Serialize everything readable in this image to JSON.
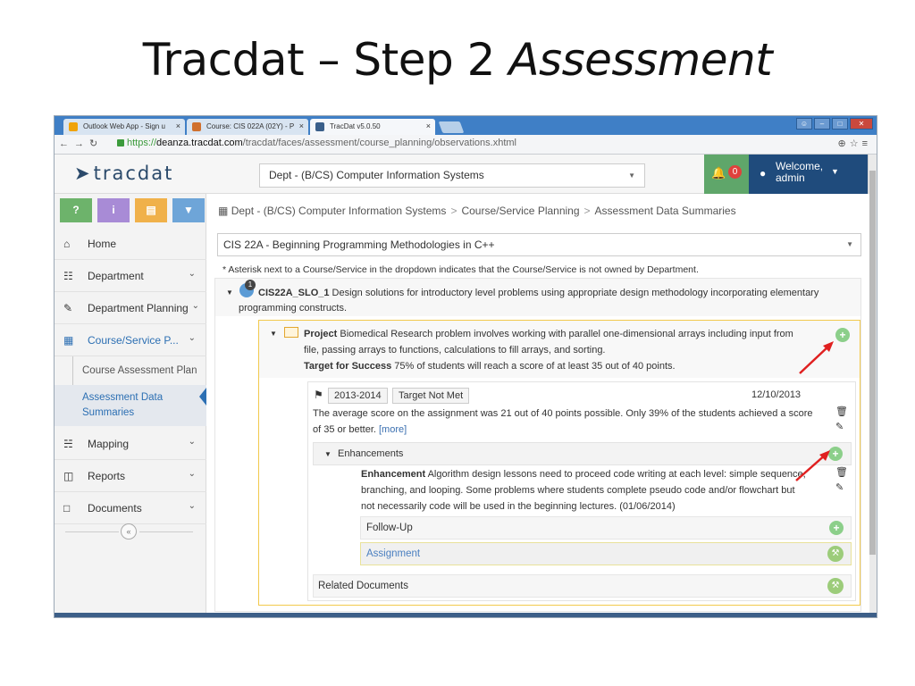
{
  "slide": {
    "title_main": "Tracdat – Step 2 ",
    "title_italic": "Assessment"
  },
  "browser": {
    "tabs": [
      {
        "label": "Outlook Web App - Sign u",
        "icon_color": "#f0a30a"
      },
      {
        "label": "Course: CIS 022A (02Y) - P",
        "icon_color": "#d0702e"
      },
      {
        "label": "TracDat v5.0.50",
        "icon_color": "#3a5f8a"
      }
    ],
    "tab_close": "×",
    "url_scheme": "https://",
    "url_host": "deanza.tracdat.com",
    "url_path": "/tracdat/faces/assessment/course_planning/observations.xhtml"
  },
  "header": {
    "logo": "tracdat",
    "department": "Dept - (B/CS) Computer Information Systems",
    "notifications": "0",
    "welcome_line1": "Welcome,",
    "welcome_line2": "admin"
  },
  "sidebar": {
    "quick_buttons": [
      {
        "label": "?",
        "color": "#6db36b",
        "name": "help"
      },
      {
        "label": "i",
        "color": "#a88bd6",
        "name": "info"
      },
      {
        "label": "▤",
        "color": "#f0b14a",
        "name": "notes"
      },
      {
        "label": "▼",
        "color": "#6ea5d8",
        "name": "filter"
      }
    ],
    "items": [
      {
        "label": "Home",
        "icon": "home-icon"
      },
      {
        "label": "Department",
        "icon": "institution-icon"
      },
      {
        "label": "Department Planning",
        "icon": "pencil-icon"
      },
      {
        "label": "Course/Service P...",
        "icon": "book-icon"
      },
      {
        "label": "Mapping",
        "icon": "sitemap-icon"
      },
      {
        "label": "Reports",
        "icon": "columns-icon"
      },
      {
        "label": "Documents",
        "icon": "folder-icon"
      }
    ],
    "subitems": [
      {
        "label": "Course Assessment Plan"
      },
      {
        "label": "Assessment Data Summaries"
      }
    ],
    "collapse": "«"
  },
  "breadcrumb": {
    "items": [
      "Dept - (B/CS) Computer Information Systems",
      "Course/Service Planning",
      "Assessment Data Summaries"
    ],
    "sep": ">"
  },
  "course": {
    "selected": "CIS 22A - Beginning Programming Methodologies in C++",
    "note": "* Asterisk next to a Course/Service in the dropdown indicates that the Course/Service is not owned by Department."
  },
  "slo": {
    "count": "1",
    "code": "CIS22A_SLO_1",
    "text": "Design solutions for introductory level problems using appropriate design methodology incorporating elementary programming constructs."
  },
  "project": {
    "label": "Project",
    "text": "Biomedical Research problem involves working with parallel one-dimensional arrays including input from file, passing arrays to functions, calculations to fill arrays, and sorting.",
    "target_label": "Target for Success",
    "target_text": "75% of students will reach a score of at least 35 out of 40 points."
  },
  "observation": {
    "year": "2013-2014",
    "status": "Target Not Met",
    "date": "12/10/2013",
    "text": "The average score on the assignment was 21 out of 40 points possible. Only 39% of the students achieved a score of 35 or better.",
    "more": "[more]",
    "enhancements_label": "Enhancements",
    "enhancement_label": "Enhancement",
    "enhancement_text": "Algorithm design lessons need to proceed code writing at each level: simple sequence, branching, and looping. Some problems where students complete pseudo code and/or flowchart but not necessarily code will be used in the beginning lectures. (01/06/2014)",
    "followup_label": "Follow-Up",
    "assignment_label": "Assignment",
    "related_label": "Related Documents"
  }
}
